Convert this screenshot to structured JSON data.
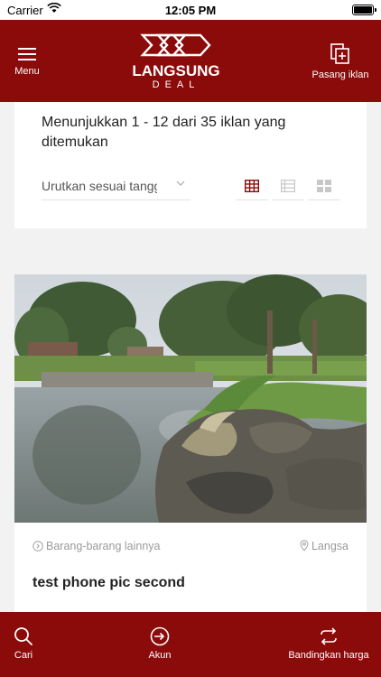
{
  "status_bar": {
    "carrier": "Carrier",
    "time": "12:05 PM"
  },
  "header": {
    "menu_label": "Menu",
    "logo_brand": "LANGSUNG",
    "logo_sub": "DEAL",
    "post_ad_label": "Pasang iklan"
  },
  "results": {
    "summary": "Menunjukkan 1 - 12 dari 35 iklan yang ditemukan",
    "sort_value": "Urutkan sesuai tanggal",
    "active_view": "list-grid"
  },
  "listing": {
    "category": "Barang-barang lainnya",
    "location": "Langsa",
    "title": "test phone pic second"
  },
  "tabbar": {
    "search_label": "Cari",
    "account_label": "Akun",
    "compare_label": "Bandingkan harga"
  },
  "colors": {
    "brand": "#8b0a0a",
    "muted": "#9a9a9a"
  },
  "icons": {
    "menu": "hamburger-icon",
    "post_ad": "add-document-icon",
    "view_1": "grid-icon",
    "view_2": "list-icon",
    "view_3": "tiles-icon",
    "category": "tag-icon",
    "location": "location-pin-icon",
    "search": "search-icon",
    "account": "login-icon",
    "compare": "swap-icon"
  }
}
